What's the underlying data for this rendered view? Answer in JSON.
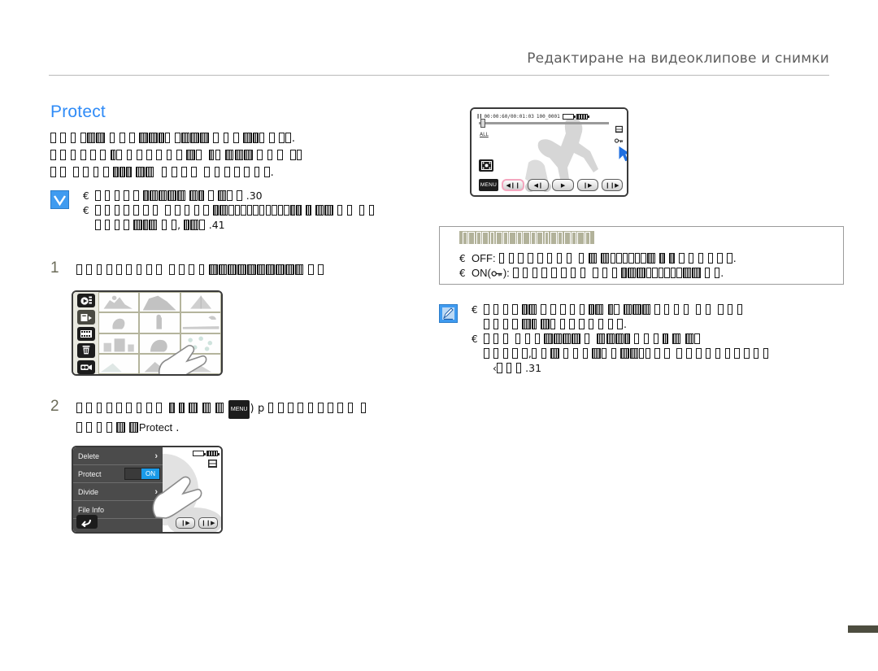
{
  "page": {
    "running_header": "Редактиране на видеоклипове и снимки",
    "section_title": "Protect",
    "page_tab": ""
  },
  "intro": {
    "lines": [
      "[tofu] [tofu] [tofu] [tofu] [tofu] [tofu] [tofu] [tofu] [tofu] [tofu] [tofu] [tofu] [tofu] [tofu] [tofu] [tofu] [tofu] [tofu] [tofu] [tofu] [tofu] [tofu] [tofu] [tofu] [tofu] [tofu] [tofu] [tofu].",
      "[tofu] [tofu] [tofu] [tofu] [tofu] [tofu] [tofu] [tofu] [tofu] [tofu] [tofu] [tofu] [tofu] [tofu] [tofu] [tofu] [tofu] [tofu] [tofu] [tofu] [tofu] [tofu] [tofu] [tofu] [tofu] [tofu]",
      "[tofu] [tofu] [tofu] [tofu] [tofu] [tofu] [tofu] [tofu] [tofu] [tofu] [tofu] [tofu] [tofu] [tofu] [tofu] [tofu] [tofu] [tofu] [tofu] [tofu] [tofu]."
    ]
  },
  "check_note": {
    "icon": "checkmark-icon",
    "bullet": "€",
    "items": [
      {
        "text": "[tofu] [tofu] [tofu] [tofu] [tofu] [tofu] [tofu] [tofu] [tofu] [tofu] [tofu] [tofu]",
        "page_ref": "30"
      },
      {
        "text": "[tofu] [tofu] [tofu] [tofu] [tofu] [tofu] [tofu] [tofu] [tofu] [tofu] [tofu] [tofu] [tofu] [tofu] [tofu] [tofu] [tofu] [tofu] [tofu] [tofu] [tofu] [tofu] [tofu] [tofu] [tofu] [tofu]",
        "cont": "[tofu] [tofu] [tofu] [tofu] [tofu] [tofu] [tofu] [tofu] [tofu] [tofu] [tofu] [tofu]",
        "page_ref": "41"
      }
    ]
  },
  "steps": [
    {
      "num": "1",
      "lines": [
        "[tofu] [tofu] [tofu] [tofu] [tofu] [tofu] [tofu] [tofu] [tofu] [tofu] [tofu] [tofu] [tofu] [tofu] [tofu] [tofu] [tofu] [tofu] [tofu] [tofu] [tofu] [tofu] [tofu] [tofu]"
      ]
    },
    {
      "num": "2",
      "lines": [
        "[tofu] [tofu] [tofu] [tofu] [tofu] [tofu] [tofu] [tofu] [tofu] [tofu] [tofu] [tofu] [tofu] [tofu] [MENU]) p [tofu] [tofu] [tofu] [tofu] [tofu] [tofu] [tofu] [tofu] [tofu] [tofu]",
        "[tofu] [tofu] [tofu] [tofu] [tofu] [tofu] Protect ."
      ],
      "inline_menu_label": "MENU",
      "inline_arrow": "p",
      "inline_option": "Protect"
    }
  ],
  "playback_screen": {
    "name": "camcorder-playback-screen",
    "pause_icon": "pause-icon",
    "timecode": "00:00:60/00:01:03",
    "file_number": "100_0001",
    "card_icon": "memory-card-icon",
    "battery_icon": "battery-icon",
    "all_tag": "ALL",
    "sd_icon": "sd-card-icon",
    "key_icon": "protect-key-icon",
    "grid_icon": "thumbnail-grid-icon",
    "menu_label": "MENU",
    "cursor": "cursor-arrow",
    "buttons": [
      {
        "name": "step-back-button",
        "glyph": "◀❙❙",
        "selected": true
      },
      {
        "name": "previous-button",
        "glyph": "◀❙",
        "selected": false
      },
      {
        "name": "play-button",
        "glyph": "▶",
        "selected": false
      },
      {
        "name": "next-button",
        "glyph": "❙▶",
        "selected": false
      },
      {
        "name": "skip-forward-button",
        "glyph": "❙❙▶",
        "selected": false
      }
    ]
  },
  "thumbnail_screen": {
    "name": "thumbnail-grid-screen",
    "rail_icons": [
      "play-mode-icon",
      "share-mark-icon",
      "film-strip-icon",
      "trash-icon",
      "camera-icon"
    ],
    "hand": "hand-pointer-icon",
    "rows": 4,
    "cols": 3
  },
  "menu_screen": {
    "name": "protect-menu-screen",
    "items": [
      {
        "label": "Delete",
        "control": "chevron",
        "value": ""
      },
      {
        "label": "Protect",
        "control": "toggle",
        "value": "ON"
      },
      {
        "label": "Divide",
        "control": "chevron",
        "value": ""
      },
      {
        "label": "File Info",
        "control": "chevron",
        "value": ""
      }
    ],
    "chevron": "›",
    "back_icon": "back-arrow-icon",
    "battery_icon": "battery-icon",
    "sd_icon": "sd-card-icon",
    "hand": "hand-pointer-icon",
    "buttons": [
      {
        "name": "next-button",
        "glyph": "❙▶"
      },
      {
        "name": "skip-forward-button",
        "glyph": "❙❙▶"
      }
    ]
  },
  "option_box": {
    "name": "protect-options-box",
    "header_tofu": "[tofu][tofu][tofu][tofu][tofu][tofu][tofu][tofu][tofu][tofu][tofu]",
    "bullet": "€",
    "options": [
      {
        "label": "OFF:",
        "key_icon": false,
        "text": "[tofu] [tofu] [tofu] [tofu] [tofu] [tofu] [tofu] [tofu] [tofu] [tofu] [tofu] [tofu] [tofu] [tofu] [tofu] [tofu] [tofu] [tofu]."
      },
      {
        "label": "ON(",
        "label_suffix": "):",
        "key_icon": true,
        "key_icon_name": "protect-key-icon",
        "text": "[tofu] [tofu] [tofu] [tofu] [tofu] [tofu] [tofu] [tofu] [tofu] [tofu] [tofu] [tofu] [tofu] [tofu] [tofu] [tofu]."
      }
    ]
  },
  "note_box": {
    "name": "note-box",
    "icon": "note-pencil-icon",
    "bullet": "€",
    "items": [
      {
        "line1": "[tofu] [tofu] [tofu] [tofu] [tofu] [tofu] [tofu] [tofu] [tofu] [tofu] [tofu] [tofu] [tofu] [tofu] [tofu] [tofu] [tofu] [tofu] [tofu] [tofu] [tofu] [tofu]",
        "line2": "[tofu] [tofu] [tofu] [tofu] [tofu] [tofu] [tofu] [tofu] [tofu] [tofu] [tofu] [tofu] [tofu]."
      },
      {
        "line1": "[tofu] [tofu] [tofu] [tofu] [tofu] [tofu] [tofu] [tofu] [tofu] [tofu] [tofu] [tofu] [tofu] [tofu] [tofu] [tofu] [tofu] [tofu]",
        "line2": "[tofu] [tofu] [tofu] [tofu] [tofu], [tofu] [tofu] [tofu] [tofu] [tofu] [tofu] [tofu] [tofu] [tofu] [tofu] [tofu] [tofu] [tofu] [tofu] [tofu] [tofu] [tofu] [tofu] [tofu] [tofu] [tofu] [tofu] [tofu] [tofu] [tofu]",
        "line3_prefix": "‹",
        "line3": "[tofu] [tofu] [tofu]",
        "page_ref": "31"
      }
    ]
  },
  "colors": {
    "heading_blue": "#2f8bf7",
    "note_icon_blue": "#3f9bf0",
    "toggle_on_blue": "#1a9ae8",
    "header_gray": "#5e5e5e",
    "option_header_khaki": "#b2b29a",
    "step_number": "#6b6b58",
    "page_tab": "#4d4d3f",
    "selected_button_pink": "#f4a7bf"
  }
}
